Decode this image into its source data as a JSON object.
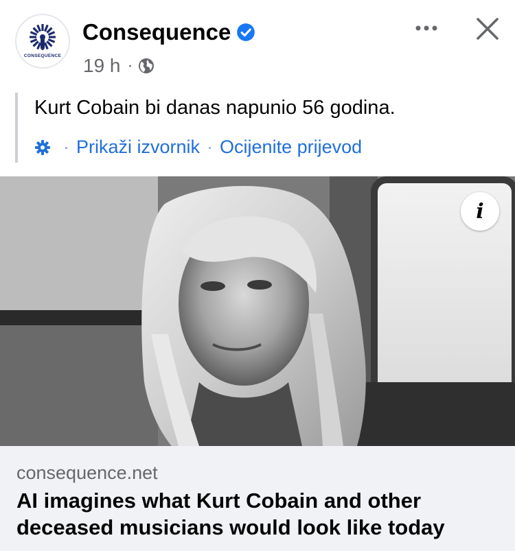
{
  "post": {
    "page_name": "Consequence",
    "avatar_label": "CONSEQUENCE",
    "time": "19 h",
    "meta_separator": "·",
    "verified": true,
    "text": "Kurt Cobain bi danas napunio 56 godina.",
    "translation": {
      "separator": "·",
      "show_original": "Prikaži izvornik",
      "rate_translation": "Ocijenite prijevod"
    }
  },
  "link": {
    "domain": "consequence.net",
    "title": "AI imagines what Kurt Cobain and other deceased musicians would look like today",
    "info_label": "i"
  },
  "icons": {
    "verified": "verified-badge-icon",
    "privacy": "globe-icon",
    "more": "more-options-icon",
    "close": "close-icon",
    "settings": "gear-icon",
    "info": "info-icon"
  },
  "colors": {
    "link_blue": "#216fdb",
    "verified_blue": "#1877f2",
    "secondary_text": "#65676b",
    "link_preview_bg": "#f0f2f5",
    "logo_navy": "#1a2a6c"
  }
}
